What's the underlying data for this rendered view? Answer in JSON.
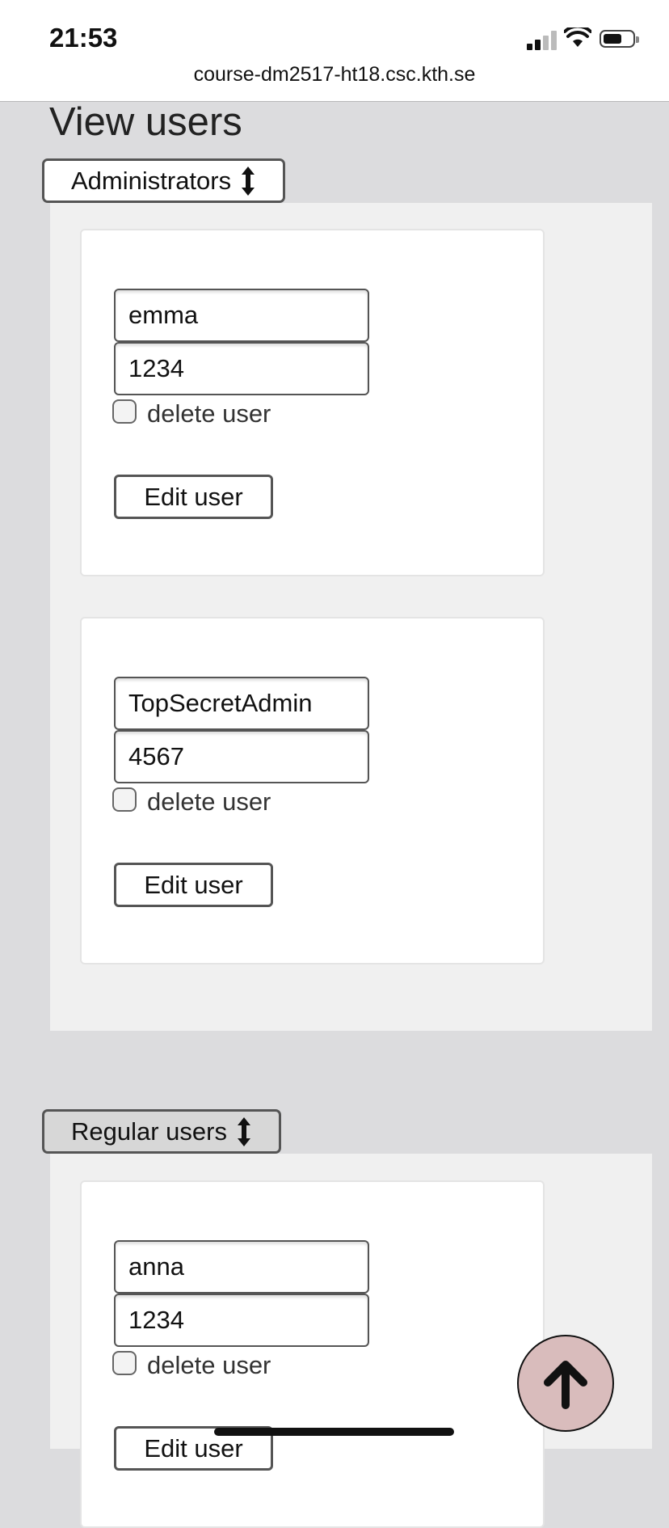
{
  "status_bar": {
    "time": "21:53",
    "url": "course-dm2517-ht18.csc.kth.se"
  },
  "page": {
    "title": "View users"
  },
  "administrators": {
    "toggle_label": "Administrators",
    "users": [
      {
        "username": "emma",
        "password": "1234",
        "delete_label": "delete user",
        "edit_label": "Edit user"
      },
      {
        "username": "TopSecretAdmin",
        "password": "4567",
        "delete_label": "delete user",
        "edit_label": "Edit user"
      }
    ]
  },
  "regular_users": {
    "toggle_label": "Regular users",
    "users": [
      {
        "username": "anna",
        "password": "1234",
        "delete_label": "delete user",
        "edit_label": "Edit user"
      }
    ]
  },
  "icons": {
    "toggle": "up-down-arrow-icon",
    "scroll_top": "arrow-up-icon",
    "signal": "cellular-signal-icon",
    "wifi": "wifi-icon",
    "battery": "battery-icon"
  },
  "colors": {
    "page_bg": "#dcdcde",
    "section_bg": "#f0f0f0",
    "card_bg": "#ffffff",
    "fab_bg": "#d9bcbc"
  }
}
